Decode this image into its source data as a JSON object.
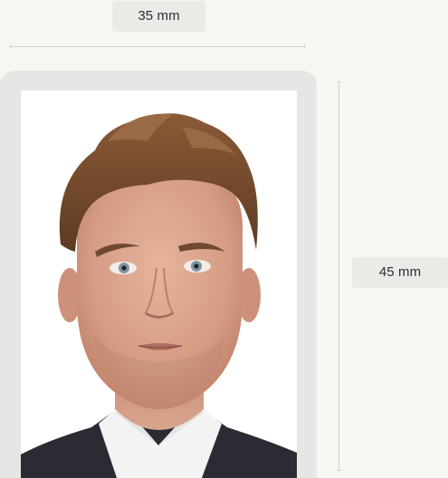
{
  "dimensions": {
    "width_label": "35 mm",
    "height_label": "45 mm"
  },
  "photo": {
    "subject": "man-portrait",
    "background_color": "#ffffff"
  },
  "colors": {
    "page_background": "#f7f7f1",
    "frame": "#e6e7e4",
    "badge": "#e9ebe7",
    "dimension_line": "#cfd1cc"
  }
}
